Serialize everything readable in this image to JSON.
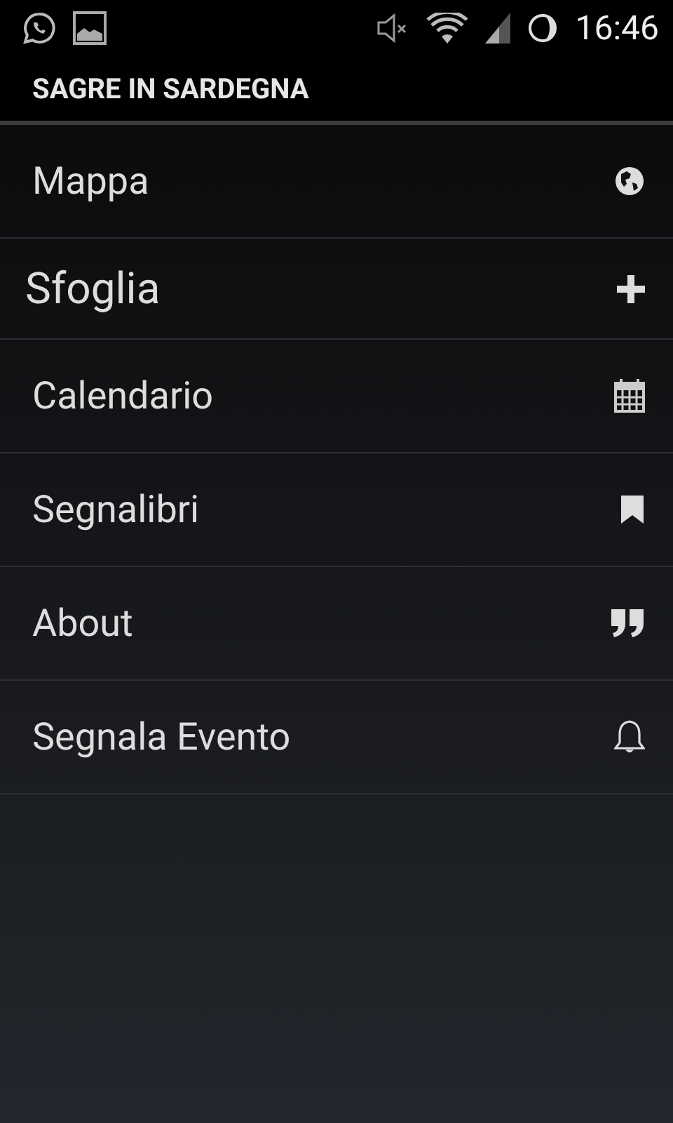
{
  "status_bar": {
    "time": "16:46"
  },
  "action_bar": {
    "title": "SAGRE IN SARDEGNA"
  },
  "menu": [
    {
      "label": "Mappa",
      "kind": "item"
    },
    {
      "label": "Sfoglia",
      "kind": "section"
    },
    {
      "label": "Calendario",
      "kind": "item"
    },
    {
      "label": "Segnalibri",
      "kind": "item"
    },
    {
      "label": "About",
      "kind": "item"
    },
    {
      "label": "Segnala Evento",
      "kind": "item"
    }
  ]
}
